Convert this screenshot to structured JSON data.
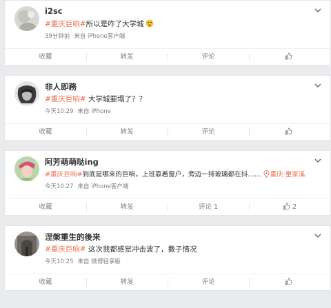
{
  "posts": [
    {
      "username": "i2sc",
      "hashtag": "#重庆巨响#",
      "text": "所以是咋了大学城",
      "emoji_icon": "dizzy-face-emoji-icon",
      "time": "39分钟前",
      "source": "来自 iPhone客户端",
      "actions": {
        "favorite": "收藏",
        "repost": "转发",
        "comment": "评论",
        "like_count": ""
      }
    },
    {
      "username": "非人即務",
      "hashtag": "#重庆巨响#",
      "text": " 大学城要塌了？？",
      "time": "今天10:29",
      "source": "来自 iPhone",
      "actions": {
        "favorite": "收藏",
        "repost": "转发",
        "comment": "评论",
        "like_count": ""
      }
    },
    {
      "username": "阿芳萌萌哒ing",
      "hashtag": "#重庆巨响#",
      "text": "到底是哪来的巨响，上班靠着窗户，旁边一排玻璃都在抖……",
      "location": "重庆·童家溪",
      "time": "今天10:27",
      "source": "来自 iPhone客户端",
      "actions": {
        "favorite": "收藏",
        "repost": "转发",
        "comment": "评论 1",
        "like_count": "2"
      }
    },
    {
      "username": "涅槃重生的後来",
      "hashtag": "#重庆巨响#",
      "text": " 这次我都感觉冲击波了，撒子情况",
      "time": "今天10:25",
      "source": "来自 微博轻享版",
      "actions": {
        "favorite": "收藏",
        "repost": "转发",
        "comment": "评论",
        "like_count": ""
      }
    }
  ],
  "colors": {
    "accent": "#eb7350",
    "background": "#e9ebed",
    "meta_text": "#808080"
  }
}
